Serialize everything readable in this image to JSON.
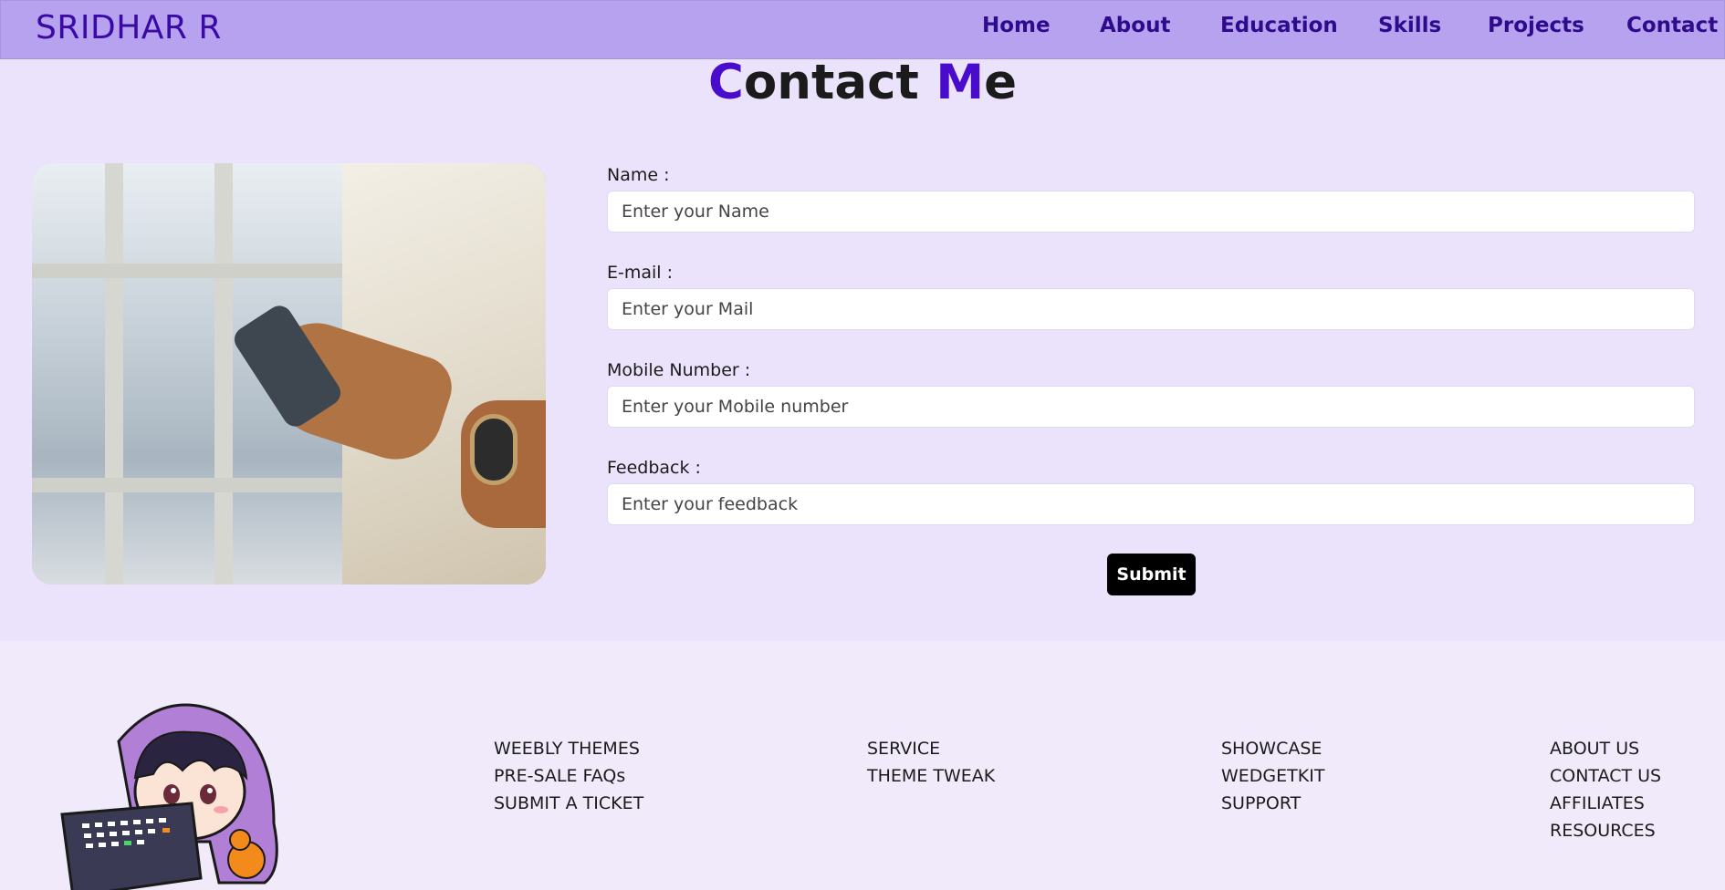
{
  "navbar": {
    "brand": "SRIDHAR R",
    "items": [
      {
        "label": "Home"
      },
      {
        "label": "About"
      },
      {
        "label": "Education"
      },
      {
        "label": "Skills"
      },
      {
        "label": "Projects"
      },
      {
        "label": "Contact"
      }
    ]
  },
  "heading": {
    "first_letter": "C",
    "first_rest": "ontact ",
    "second_letter": "M",
    "second_rest": "e"
  },
  "form": {
    "name": {
      "label": "Name :",
      "placeholder": "Enter your Name"
    },
    "email": {
      "label": "E-mail :",
      "placeholder": "Enter your Mail"
    },
    "mobile": {
      "label": "Mobile Number :",
      "placeholder": "Enter your Mobile number"
    },
    "feedback": {
      "label": "Feedback :",
      "placeholder": "Enter your feedback"
    },
    "submit_label": "Submit"
  },
  "footer": {
    "columns": [
      [
        "WEEBLY THEMES",
        "PRE-SALE FAQs",
        "SUBMIT A TICKET"
      ],
      [
        "SERVICE",
        "THEME TWEAK"
      ],
      [
        "SHOWCASE",
        "WEDGETKIT",
        "SUPPORT"
      ],
      [
        "ABOUT US",
        "CONTACT US",
        "AFFILIATES",
        "RESOURCES"
      ]
    ]
  },
  "colors": {
    "navbar_bg": "#b7a2ef",
    "page_bg": "#ebe3fb",
    "footer_bg": "#f0eafb",
    "accent": "#4a0ccc",
    "button_bg": "#000000"
  }
}
